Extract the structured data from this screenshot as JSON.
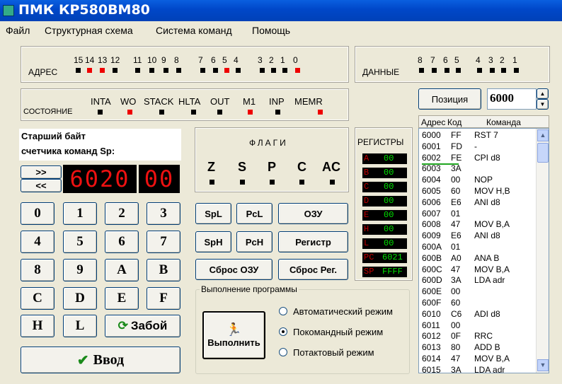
{
  "title": "ПМК КР580ВМ80",
  "menu": [
    "Файл",
    "Структурная схема",
    "Система команд",
    "Помощь"
  ],
  "address": {
    "label": "АДРЕС",
    "bits": [
      "15",
      "14",
      "13",
      "12",
      "11",
      "10",
      "9",
      "8",
      "7",
      "6",
      "5",
      "4",
      "3",
      "2",
      "1",
      "0"
    ],
    "leds": [
      0,
      1,
      1,
      0,
      0,
      0,
      0,
      0,
      0,
      0,
      1,
      0,
      0,
      0,
      0,
      1
    ]
  },
  "data_panel": {
    "label": "ДАННЫЕ",
    "bits": [
      "8",
      "7",
      "6",
      "5",
      "4",
      "3",
      "2",
      "1"
    ],
    "leds": [
      0,
      0,
      0,
      0,
      0,
      0,
      0,
      0
    ]
  },
  "state": {
    "label": "СОСТОЯНИЕ",
    "signals": [
      "INTA",
      "WO",
      "STACK",
      "HLTA",
      "OUT",
      "M1",
      "INP",
      "MEMR"
    ],
    "leds": [
      0,
      1,
      0,
      0,
      0,
      1,
      0,
      1
    ]
  },
  "position": {
    "button": "Позиция",
    "value": "6000"
  },
  "pc_caption": {
    "line1": "Старший байт",
    "line2": "счетчика команд Sp:"
  },
  "nav": {
    "next": ">>",
    "prev": "<<"
  },
  "display": {
    "address": "6020",
    "data": "00"
  },
  "keypad": {
    "keys": [
      "0",
      "1",
      "2",
      "3",
      "4",
      "5",
      "6",
      "7",
      "8",
      "9",
      "A",
      "B",
      "C",
      "D",
      "E",
      "F",
      "H",
      "L"
    ],
    "clear": "Забой",
    "enter": "Ввод"
  },
  "flags": {
    "title": "ФЛАГИ",
    "names": [
      "Z",
      "S",
      "P",
      "C",
      "AC"
    ]
  },
  "registers": {
    "title": "РЕГИСТРЫ",
    "items": [
      {
        "name": "A",
        "value": "00"
      },
      {
        "name": "B",
        "value": "00"
      },
      {
        "name": "C",
        "value": "00"
      },
      {
        "name": "D",
        "value": "00"
      },
      {
        "name": "E",
        "value": "00"
      },
      {
        "name": "H",
        "value": "00"
      },
      {
        "name": "L",
        "value": "00"
      },
      {
        "name": "PC",
        "value": "6021"
      },
      {
        "name": "SP",
        "value": "FFFF"
      }
    ]
  },
  "control": {
    "spl": "SpL",
    "pcl": "PcL",
    "ozu": "ОЗУ",
    "sph": "SpH",
    "pch": "PcH",
    "register": "Регистр",
    "reset_ozu": "Сброс ОЗУ",
    "reset_reg": "Сброс Рег."
  },
  "execution": {
    "title": "Выполнение программы",
    "run": "Выполнить",
    "modes": [
      "Автоматический режим",
      "Покомандный режим",
      "Потактовый режим"
    ],
    "selected": 1
  },
  "listing": {
    "headers": [
      "Адрес",
      "Код",
      "Команда"
    ],
    "rows": [
      [
        "6000",
        "FF",
        "RST 7"
      ],
      [
        "6001",
        "FD",
        "-"
      ],
      [
        "6002",
        "FE",
        "CPI d8"
      ],
      [
        "6003",
        "3A",
        ""
      ],
      [
        "6004",
        "00",
        "NOP"
      ],
      [
        "6005",
        "60",
        "MOV H,B"
      ],
      [
        "6006",
        "E6",
        "ANI d8"
      ],
      [
        "6007",
        "01",
        ""
      ],
      [
        "6008",
        "47",
        "MOV B,A"
      ],
      [
        "6009",
        "E6",
        "ANI d8"
      ],
      [
        "600A",
        "01",
        ""
      ],
      [
        "600B",
        "A0",
        "ANA B"
      ],
      [
        "600C",
        "47",
        "MOV B,A"
      ],
      [
        "600D",
        "3A",
        "LDA adr"
      ],
      [
        "600E",
        "00",
        ""
      ],
      [
        "600F",
        "60",
        ""
      ],
      [
        "6010",
        "C6",
        "ADI d8"
      ],
      [
        "6011",
        "00",
        ""
      ],
      [
        "6012",
        "0F",
        "RRC"
      ],
      [
        "6013",
        "80",
        "ADD B"
      ],
      [
        "6014",
        "47",
        "MOV B,A"
      ],
      [
        "6015",
        "3A",
        "LDA adr"
      ]
    ]
  }
}
